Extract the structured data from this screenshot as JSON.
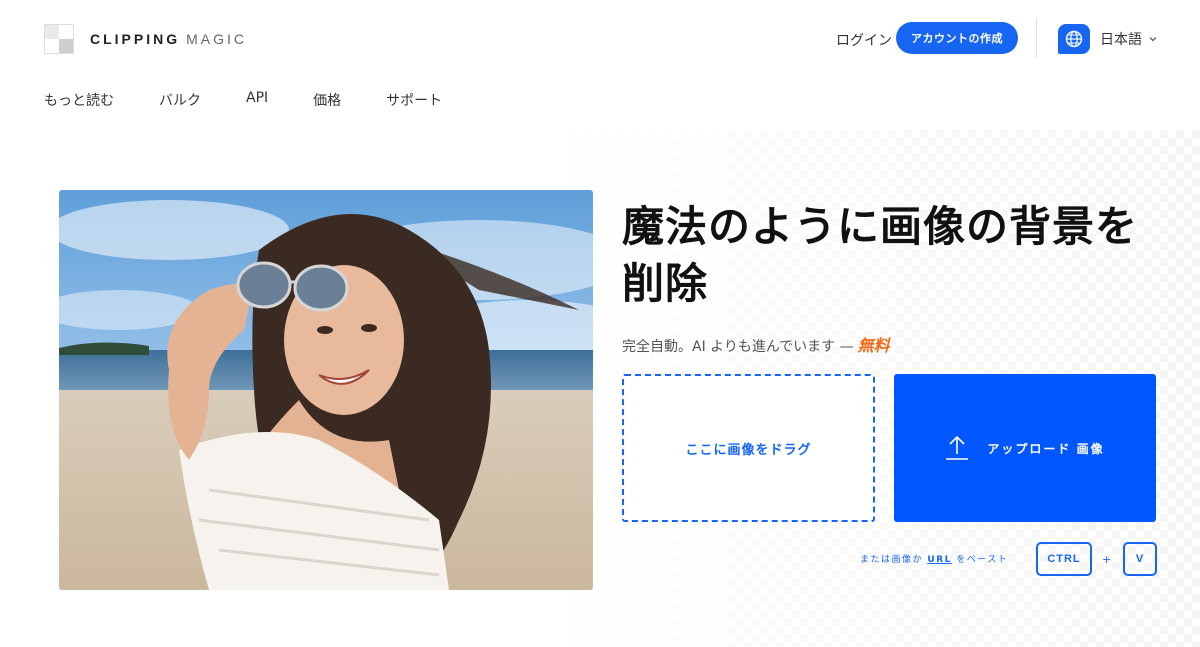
{
  "brand": {
    "name_bold": "CLIPPING",
    "name_light": "MAGIC"
  },
  "header": {
    "login": "ログイン",
    "signup": "アカウントの作成",
    "language": "日本語"
  },
  "nav": {
    "items": [
      "もっと読む",
      "バルク",
      "API",
      "価格",
      "サポート"
    ]
  },
  "hero": {
    "headline": "魔法のように画像の背景を削除",
    "subline": "完全自動。AI よりも進んでいます —",
    "free": "無料",
    "drop_label": "ここに画像をドラグ",
    "upload_label": "アップロード 画像",
    "paste_prefix": "または画像か",
    "paste_url": "URL",
    "paste_suffix": "をペースト",
    "key_ctrl": "CTRL",
    "key_plus": "+",
    "key_v": "V"
  },
  "colors": {
    "accent": "#1766f3",
    "upload_bg": "#0057ff",
    "free": "#f26a14"
  },
  "icons": [
    "logo-mark-icon",
    "globe-icon",
    "chevron-down-icon",
    "upload-arrow-icon"
  ]
}
